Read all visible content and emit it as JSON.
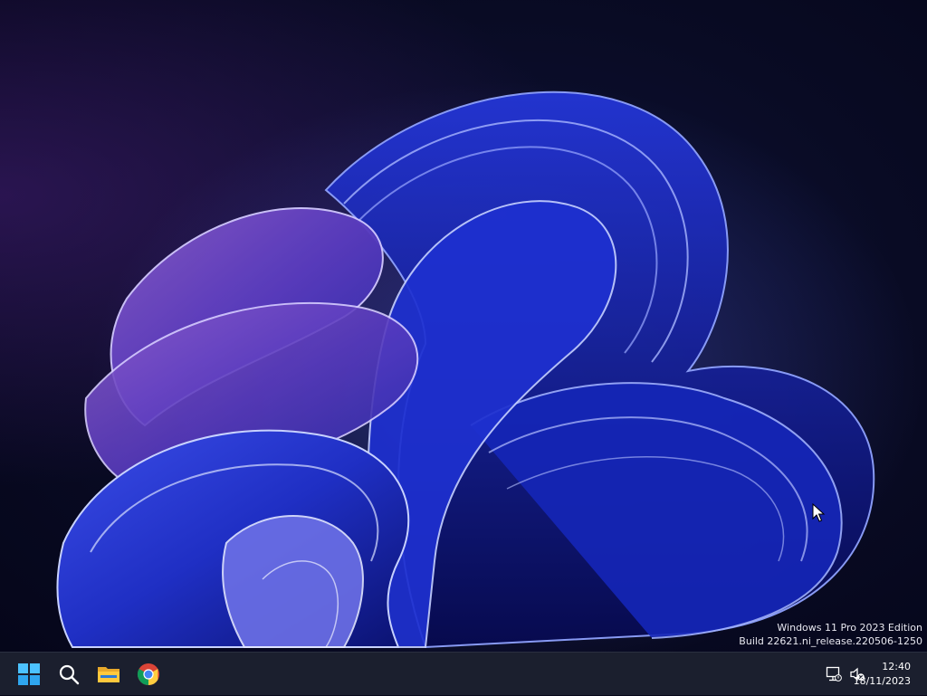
{
  "desktop": {
    "wallpaper_icon": "windows-11-bloom-wallpaper",
    "accent_color": "#2a3bd6",
    "background_color": "#090b24"
  },
  "watermark": {
    "line1": "Windows 11 Pro 2023 Edition",
    "line2": "Build 22621.ni_release.220506-1250"
  },
  "taskbar": {
    "background_color": "#1b1f2e",
    "pinned": [
      {
        "name": "start",
        "icon": "windows-logo-icon"
      },
      {
        "name": "search",
        "icon": "search-icon"
      },
      {
        "name": "file-explorer",
        "icon": "folder-icon"
      },
      {
        "name": "chrome",
        "icon": "chrome-icon"
      }
    ],
    "tray": {
      "network_icon": "network-disconnected-icon",
      "volume_icon": "volume-muted-icon",
      "time": "12:40",
      "date": "18/11/2023"
    }
  }
}
